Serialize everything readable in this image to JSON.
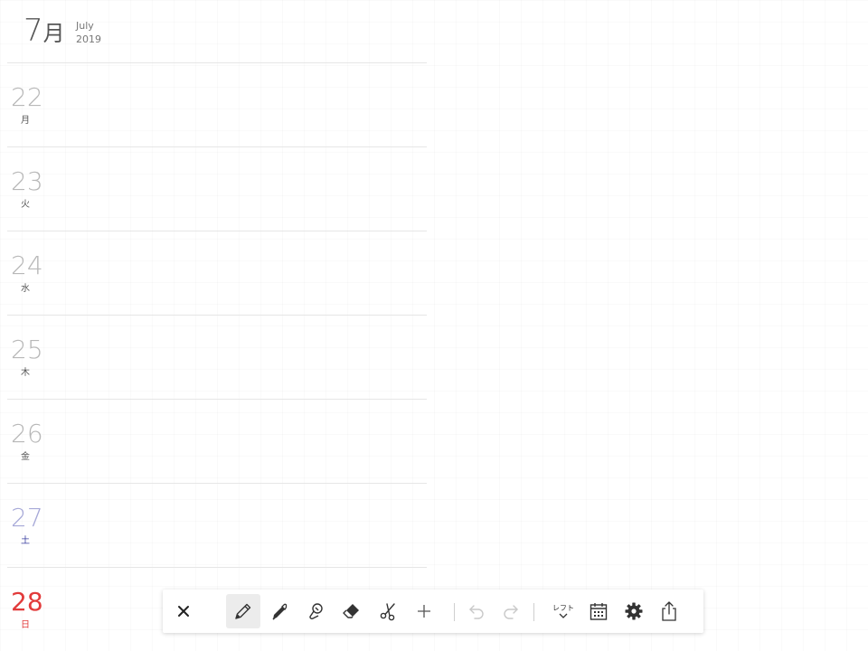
{
  "header": {
    "month_number": "7",
    "month_kanji": "月",
    "month_english": "July",
    "year": "2019"
  },
  "days": [
    {
      "day": "22",
      "weekday": "月",
      "type": "weekday"
    },
    {
      "day": "23",
      "weekday": "火",
      "type": "weekday"
    },
    {
      "day": "24",
      "weekday": "水",
      "type": "weekday"
    },
    {
      "day": "25",
      "weekday": "木",
      "type": "weekday"
    },
    {
      "day": "26",
      "weekday": "金",
      "type": "weekday"
    },
    {
      "day": "27",
      "weekday": "土",
      "type": "saturday"
    },
    {
      "day": "28",
      "weekday": "日",
      "type": "sunday"
    }
  ],
  "toolbar": {
    "close_icon": "close-icon",
    "tools": [
      "pencil-icon",
      "marker-icon",
      "stamp-icon",
      "eraser-icon",
      "scissors-icon",
      "plus-icon"
    ],
    "undo_icon": "undo-icon",
    "redo_icon": "redo-icon",
    "layout_label": "レフト",
    "calendar_icon": "calendar-icon",
    "settings_icon": "gear-icon",
    "share_icon": "share-icon",
    "active_tool": "pencil-icon"
  },
  "colors": {
    "sunday": "#e23b3b",
    "saturday": "#3a3fa0",
    "saturday_number": "#a7a9d8",
    "day_number": "#b8b8b8",
    "divider": "#e6e6e6"
  }
}
